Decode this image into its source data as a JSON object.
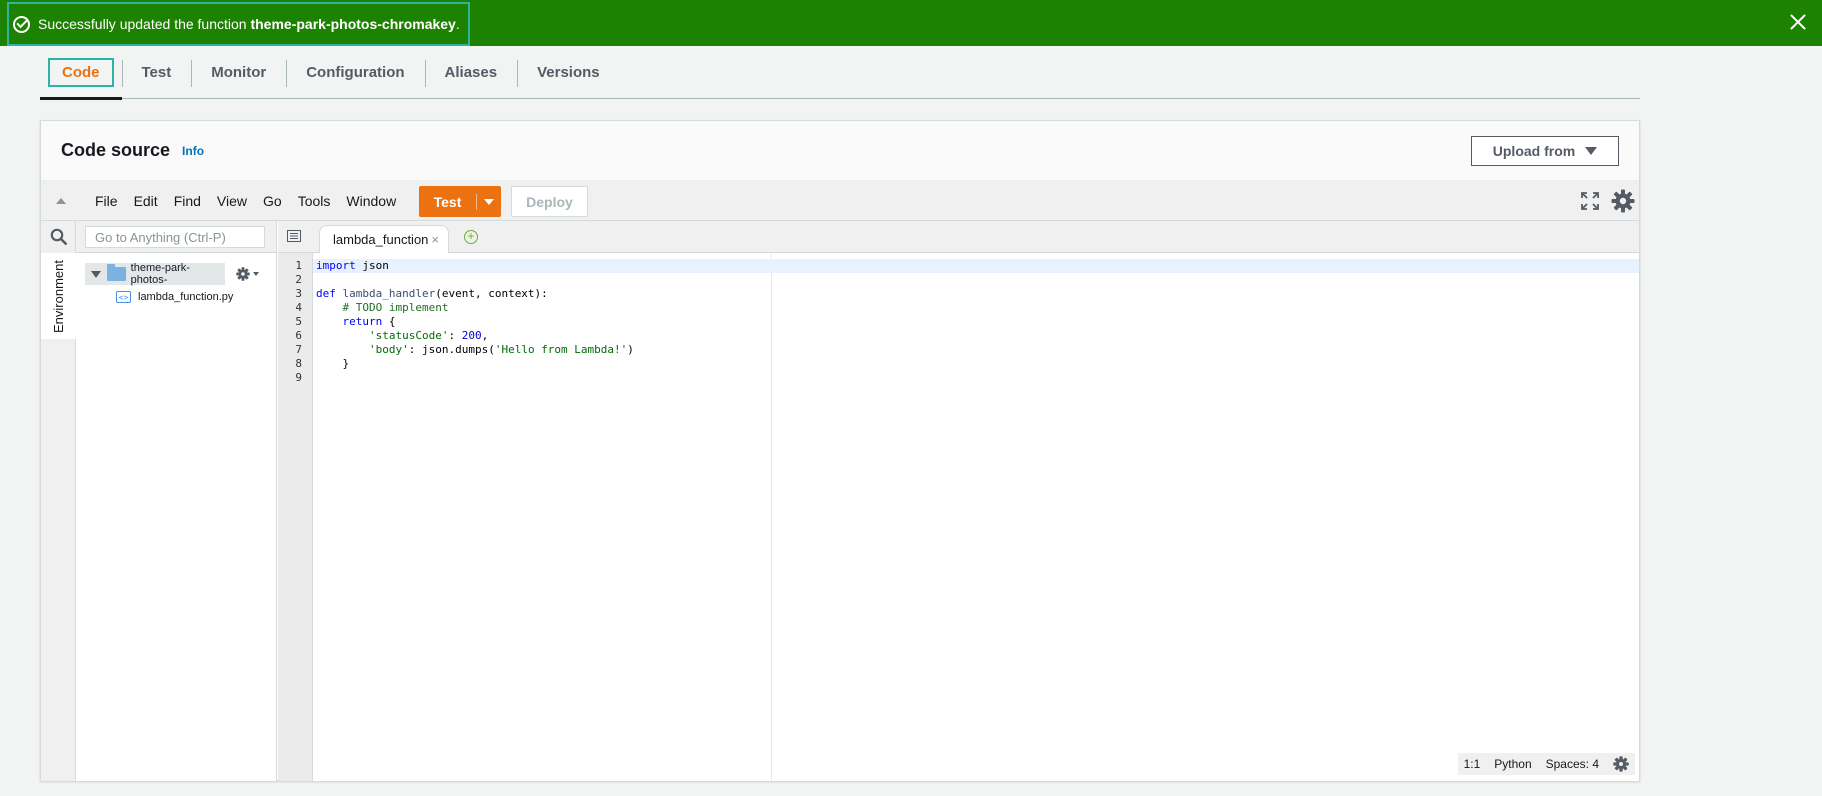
{
  "flash": {
    "prefix": "Successfully updated the function ",
    "function_name": "theme-park-photos-chromakey",
    "suffix": "."
  },
  "tabs": [
    {
      "label": "Code",
      "active": true
    },
    {
      "label": "Test"
    },
    {
      "label": "Monitor"
    },
    {
      "label": "Configuration"
    },
    {
      "label": "Aliases"
    },
    {
      "label": "Versions"
    }
  ],
  "panel": {
    "title": "Code source",
    "info": "Info",
    "upload_label": "Upload from"
  },
  "menu": [
    "File",
    "Edit",
    "Find",
    "View",
    "Go",
    "Tools",
    "Window"
  ],
  "toolbar": {
    "test_label": "Test",
    "deploy_label": "Deploy"
  },
  "sidebar": {
    "search_placeholder": "Go to Anything (Ctrl-P)",
    "env_label": "Environment",
    "folder_name": "theme-park-photos-",
    "file_name": "lambda_function.py"
  },
  "editor": {
    "tab_label": "lambda_function",
    "lines": [
      "1",
      "2",
      "3",
      "4",
      "5",
      "6",
      "7",
      "8",
      "9"
    ]
  },
  "statusbar": {
    "position": "1:1",
    "language": "Python",
    "spaces": "Spaces: 4"
  },
  "colors": {
    "flash_bg": "#1d8102",
    "accent": "#ec7211",
    "highlight_border": "#2bb3a3",
    "link": "#0073bb"
  }
}
